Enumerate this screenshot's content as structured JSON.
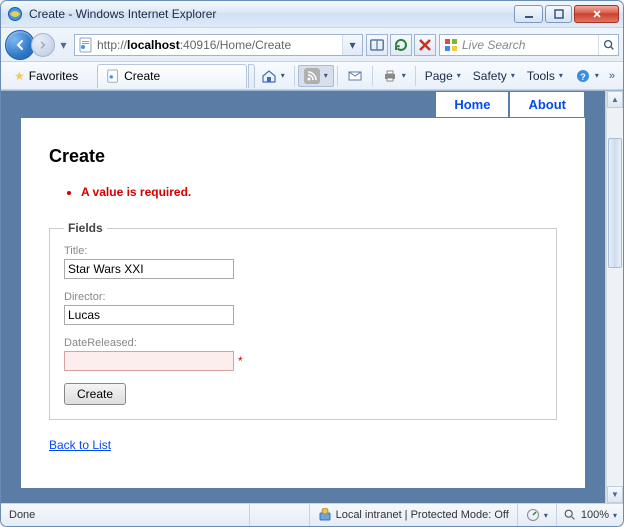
{
  "window": {
    "title": "Create - Windows Internet Explorer"
  },
  "nav": {
    "url_proto": "http://",
    "url_host": "localhost",
    "url_rest": ":40916/Home/Create",
    "search_placeholder": "Live Search"
  },
  "favbar": {
    "favorites_label": "Favorites",
    "tab_label": "Create"
  },
  "cmdbar": {
    "page_label": "Page",
    "safety_label": "Safety",
    "tools_label": "Tools"
  },
  "page": {
    "nav": {
      "home": "Home",
      "about": "About"
    },
    "heading": "Create",
    "validation_msg": "A value is required.",
    "legend": "Fields",
    "fields": {
      "title_label": "Title:",
      "title_value": "Star Wars XXI",
      "director_label": "Director:",
      "director_value": "Lucas",
      "date_label": "DateReleased:",
      "date_value": ""
    },
    "submit_label": "Create",
    "back_label": "Back to List"
  },
  "status": {
    "done": "Done",
    "zone": "Local intranet | Protected Mode: Off",
    "zoom": "100%"
  }
}
